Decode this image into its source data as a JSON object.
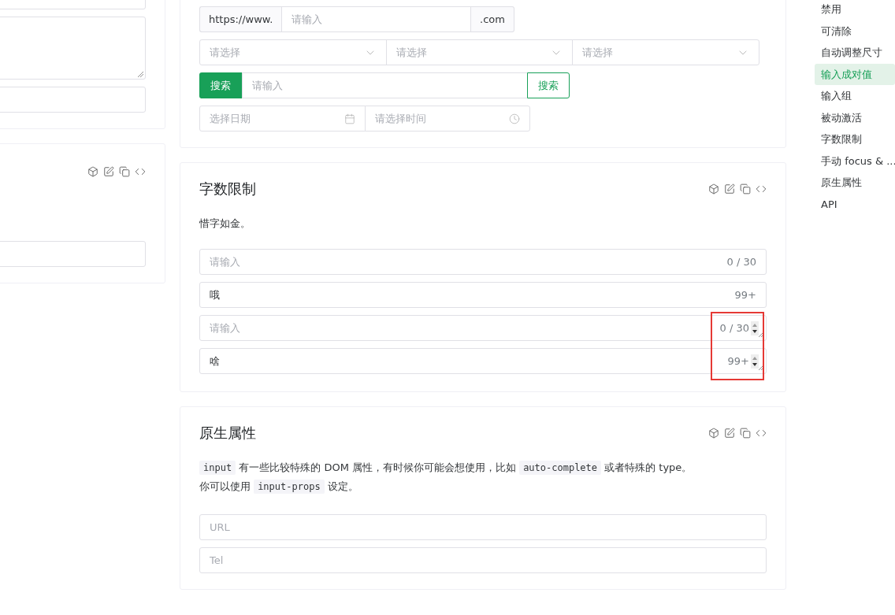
{
  "left_panel": {
    "cards": [
      {
        "toolbar": false,
        "fields": [
          {
            "kind": "input"
          },
          {
            "kind": "textarea"
          },
          {
            "kind": "input"
          }
        ]
      },
      {
        "toolbar": true,
        "fields": [
          {
            "kind": "input"
          }
        ]
      }
    ]
  },
  "input_pairs_demo": {
    "prepend_group": {
      "prepend": "https://www.",
      "placeholder": "请输入",
      "append": ".com"
    },
    "selects": [
      {
        "placeholder": "请选择"
      },
      {
        "placeholder": "请选择"
      },
      {
        "placeholder": "请选择"
      }
    ],
    "search_group": {
      "prepend_button": "搜索",
      "placeholder": "请输入",
      "append_button": "搜索"
    },
    "date_time": {
      "date_placeholder": "选择日期",
      "time_placeholder": "请选择时间"
    }
  },
  "word_limit": {
    "title": "字数限制",
    "description": "惜字如金。",
    "annotation": {
      "kind": "frame"
    },
    "fields": [
      {
        "kind": "text",
        "placeholder": "请输入",
        "counter": "0 / 30"
      },
      {
        "kind": "text",
        "value": "哦",
        "counter": "99+"
      },
      {
        "kind": "number",
        "placeholder": "请输入",
        "counter": "0 / 30"
      },
      {
        "kind": "number",
        "value": "啥",
        "counter": "99+"
      }
    ]
  },
  "native_attributes": {
    "title": "原生属性",
    "paragraphs": [
      [
        {
          "kind": "code",
          "text": "input"
        },
        {
          "kind": "text",
          "text": " 有一些比较特殊的 DOM 属性，有时候你可能会想使用，比如 "
        },
        {
          "kind": "code",
          "text": "auto-complete"
        },
        {
          "kind": "text",
          "text": " 或者特殊的 type。"
        }
      ],
      [
        {
          "kind": "text",
          "text": "你可以使用 "
        },
        {
          "kind": "code",
          "text": "input-props"
        },
        {
          "kind": "text",
          "text": " 设定。"
        }
      ]
    ],
    "fields": [
      {
        "placeholder": "URL"
      },
      {
        "placeholder": "Tel"
      }
    ]
  },
  "toc": {
    "items": [
      {
        "label": "禁用",
        "selected": false
      },
      {
        "label": "可清除",
        "selected": false
      },
      {
        "label": "自动调整尺寸",
        "selected": false
      },
      {
        "label": "输入成对值",
        "selected": true
      },
      {
        "label": "输入组",
        "selected": false
      },
      {
        "label": "被动激活",
        "selected": false
      },
      {
        "label": "字数限制",
        "selected": false
      },
      {
        "label": "手动 focus & ...",
        "selected": false
      },
      {
        "label": "原生属性",
        "selected": false
      },
      {
        "label": "API",
        "selected": false
      }
    ]
  }
}
